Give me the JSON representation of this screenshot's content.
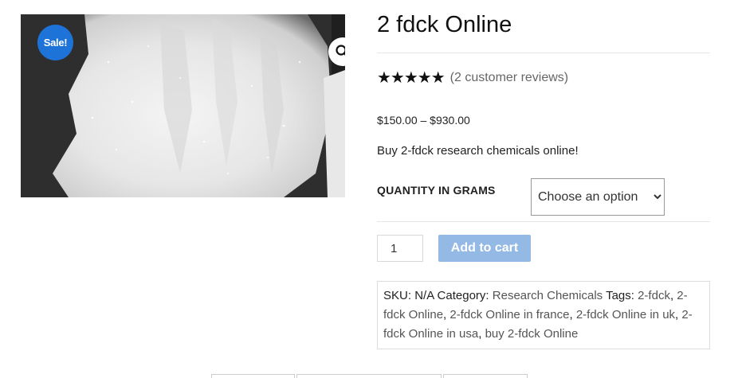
{
  "badge": {
    "sale": "Sale!"
  },
  "product": {
    "title": "2 fdck Online",
    "rating_stars": "★★★★★",
    "reviews_link": "(2 customer reviews)",
    "price": "$150.00 – $930.00",
    "short_description": "Buy 2-fdck research chemicals online!"
  },
  "variation": {
    "label": "QUANTITY IN GRAMS",
    "selected": "Choose an option"
  },
  "cart": {
    "quantity": "1",
    "add_label": "Add to cart"
  },
  "meta": {
    "sku_label": "SKU:",
    "sku_value": "N/A",
    "category_label": "Category:",
    "category": "Research Chemicals",
    "tags_label": "Tags:",
    "tags": [
      "2-fdck",
      "2-fdck Online",
      "2-fdck Online in france",
      "2-fdck Online in uk",
      "2-fdck Online in usa",
      "buy 2-fdck Online"
    ]
  },
  "colors": {
    "accent": "#1e73d8",
    "button": "#94b9e5"
  }
}
